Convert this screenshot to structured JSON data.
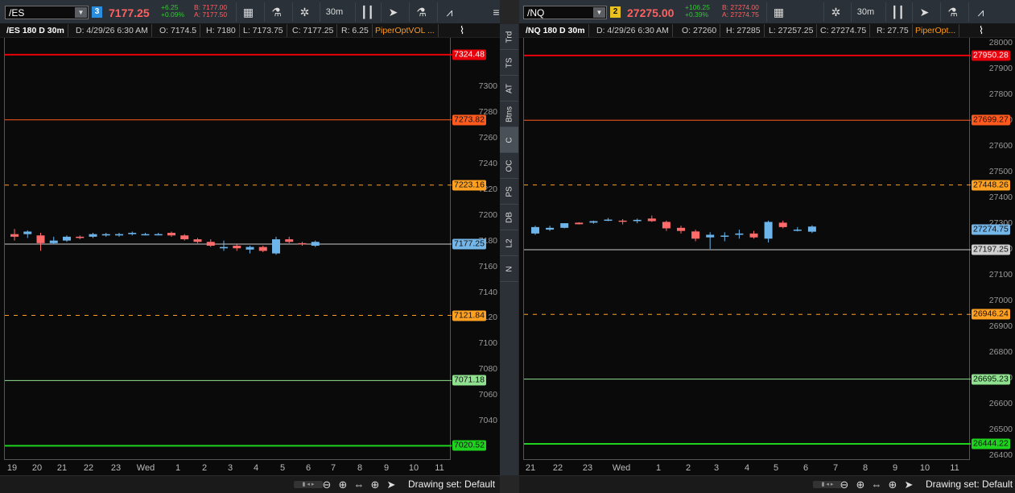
{
  "left": {
    "symbol": "/ES",
    "link": "3",
    "link_color": "#2a8ee0",
    "price": "7177.25",
    "change": "+6.25",
    "change_pct": "+0.09%",
    "bid": "B: 7177.00",
    "ask": "A: 7177.50",
    "tb_icons": [
      "calendar-icon",
      "flask-icon",
      "gear-icon"
    ],
    "timeframe": "30m",
    "tb_icons2": [
      "candles-icon",
      "cursor-icon",
      "flask-icon",
      "pattern-icon",
      "menu-icon"
    ],
    "status": {
      "title": "/ES 180 D 30m",
      "date": "D: 4/29/26 6:30 AM",
      "open": "O: 7174.5",
      "high": "H: 7180",
      "low": "L: 7173.75",
      "close": "C: 7177.25",
      "range": "R: 6.25",
      "study": "PiperOptVOL ..."
    },
    "y_ticks": [
      "7300",
      "7280",
      "7260",
      "7240",
      "7220",
      "7200",
      "7180",
      "7160",
      "7140",
      "7120",
      "7100",
      "7080",
      "7060",
      "7040"
    ],
    "levels": [
      {
        "value": "7324.48",
        "color": "#e8000b",
        "bg": "#e8000b",
        "fg": "#fff",
        "style": "solid",
        "width": 2
      },
      {
        "value": "7273.82",
        "color": "#ff5a1e",
        "bg": "#ff5a1e",
        "fg": "#111",
        "style": "solid",
        "width": 1
      },
      {
        "value": "7223.16",
        "color": "#ffa020",
        "bg": "#ffa020",
        "fg": "#111",
        "style": "dashed",
        "width": 1
      },
      {
        "value": "7177.25",
        "color": "#cccccc",
        "bg": "#74b6e8",
        "fg": "#111",
        "style": "solid",
        "width": 1
      },
      {
        "value": "7121.84",
        "color": "#ffa020",
        "bg": "#ffa020",
        "fg": "#111",
        "style": "dashed",
        "width": 1
      },
      {
        "value": "7071.18",
        "color": "#8fe08f",
        "bg": "#8fe08f",
        "fg": "#111",
        "style": "solid",
        "width": 1
      },
      {
        "value": "7020.52",
        "color": "#1ed21e",
        "bg": "#1ed21e",
        "fg": "#111",
        "style": "solid",
        "width": 2
      }
    ],
    "x_labels": [
      "19",
      "20",
      "21",
      "22",
      "23",
      "Wed",
      "1",
      "2",
      "3",
      "4",
      "5",
      "6",
      "7",
      "8",
      "9",
      "10",
      "11"
    ],
    "candles": [
      [
        7185,
        7189,
        7180,
        7183
      ],
      [
        7185,
        7188,
        7182,
        7187
      ],
      [
        7184,
        7186,
        7172,
        7178
      ],
      [
        7178,
        7183,
        7177,
        7180
      ],
      [
        7180,
        7184,
        7179,
        7183
      ],
      [
        7183,
        7184,
        7181,
        7182
      ],
      [
        7183,
        7186,
        7182,
        7185
      ],
      [
        7184,
        7186,
        7183,
        7185
      ],
      [
        7184,
        7186,
        7183,
        7185
      ],
      [
        7185,
        7187,
        7184,
        7186
      ],
      [
        7185,
        7186,
        7184,
        7185
      ],
      [
        7185,
        7186,
        7184,
        7185
      ],
      [
        7186,
        7187,
        7183,
        7184
      ],
      [
        7184,
        7185,
        7180,
        7181
      ],
      [
        7181,
        7182,
        7178,
        7179
      ],
      [
        7179,
        7181,
        7175,
        7176
      ],
      [
        7174,
        7180,
        7172,
        7175
      ],
      [
        7176,
        7177,
        7172,
        7174
      ],
      [
        7173,
        7176,
        7170,
        7175
      ],
      [
        7175,
        7176,
        7171,
        7172
      ],
      [
        7170,
        7183,
        7169,
        7181
      ],
      [
        7181,
        7183,
        7178,
        7179
      ],
      [
        7178,
        7179,
        7176,
        7177
      ],
      [
        7176,
        7180,
        7175,
        7179
      ]
    ],
    "drawing_set": "Drawing set: Default"
  },
  "side_tabs": [
    "Trd",
    "TS",
    "AT",
    "Btns",
    "C",
    "OC",
    "PS",
    "DB",
    "L2",
    "N"
  ],
  "right": {
    "symbol": "/NQ",
    "link": "2",
    "link_color": "#e8c020",
    "price": "27275.00",
    "change": "+106.25",
    "change_pct": "+0.39%",
    "bid": "B: 27274.00",
    "ask": "A: 27274.75",
    "tb_icons": [
      "calendar-icon",
      "gear-icon"
    ],
    "timeframe": "30m",
    "tb_icons2": [
      "candles-icon",
      "cursor-icon",
      "flask-icon",
      "pattern-icon"
    ],
    "status": {
      "title": "/NQ 180 D 30m",
      "date": "D: 4/29/26 6:30 AM",
      "open": "O: 27260",
      "high": "H: 27285",
      "low": "L: 27257.25",
      "close": "C: 27274.75",
      "range": "R: 27.75",
      "study": "PiperOpt..."
    },
    "y_ticks": [
      "28000",
      "27900",
      "27800",
      "27700",
      "27600",
      "27500",
      "27400",
      "27300",
      "27200",
      "27100",
      "27000",
      "26900",
      "26800",
      "26700",
      "26600",
      "26500",
      "26400"
    ],
    "levels": [
      {
        "value": "27950.28",
        "color": "#e8000b",
        "bg": "#e8000b",
        "fg": "#fff",
        "style": "solid",
        "width": 2
      },
      {
        "value": "27699.27",
        "color": "#ff5a1e",
        "bg": "#ff5a1e",
        "fg": "#111",
        "style": "solid",
        "width": 1
      },
      {
        "value": "27448.26",
        "color": "#ffa020",
        "bg": "#ffa020",
        "fg": "#111",
        "style": "dashed",
        "width": 1
      },
      {
        "value": "27274.75",
        "color": "#74b6e8",
        "bg": "#74b6e8",
        "fg": "#111",
        "style": "none",
        "width": 1
      },
      {
        "value": "27197.25",
        "color": "#cccccc",
        "bg": "#cfcfcf",
        "fg": "#111",
        "style": "solid",
        "width": 1
      },
      {
        "value": "26946.24",
        "color": "#ffa020",
        "bg": "#ffa020",
        "fg": "#111",
        "style": "dashed",
        "width": 1
      },
      {
        "value": "26695.23",
        "color": "#8fe08f",
        "bg": "#8fe08f",
        "fg": "#111",
        "style": "solid",
        "width": 1
      },
      {
        "value": "26444.22",
        "color": "#1ed21e",
        "bg": "#1ed21e",
        "fg": "#111",
        "style": "solid",
        "width": 2
      }
    ],
    "x_labels": [
      "21",
      "22",
      "23",
      "Wed",
      "1",
      "2",
      "3",
      "4",
      "5",
      "6",
      "7",
      "8",
      "9",
      "10",
      "11"
    ],
    "candles": [
      [
        27260,
        27290,
        27255,
        27285
      ],
      [
        27275,
        27290,
        27270,
        27282
      ],
      [
        27282,
        27300,
        27280,
        27300
      ],
      [
        27302,
        27304,
        27295,
        27296
      ],
      [
        27302,
        27310,
        27298,
        27308
      ],
      [
        27310,
        27320,
        27308,
        27314
      ],
      [
        27310,
        27316,
        27295,
        27306
      ],
      [
        27308,
        27318,
        27300,
        27313
      ],
      [
        27318,
        27330,
        27305,
        27308
      ],
      [
        27305,
        27310,
        27270,
        27280
      ],
      [
        27282,
        27290,
        27260,
        27270
      ],
      [
        27268,
        27275,
        27230,
        27240
      ],
      [
        27245,
        27265,
        27200,
        27255
      ],
      [
        27250,
        27265,
        27230,
        27252
      ],
      [
        27255,
        27275,
        27240,
        27260
      ],
      [
        27260,
        27270,
        27240,
        27245
      ],
      [
        27240,
        27310,
        27225,
        27305
      ],
      [
        27302,
        27310,
        27280,
        27285
      ],
      [
        27275,
        27285,
        27268,
        27275
      ],
      [
        27267,
        27292,
        27262,
        27287
      ]
    ],
    "drawing_set": "Drawing set: Default"
  }
}
